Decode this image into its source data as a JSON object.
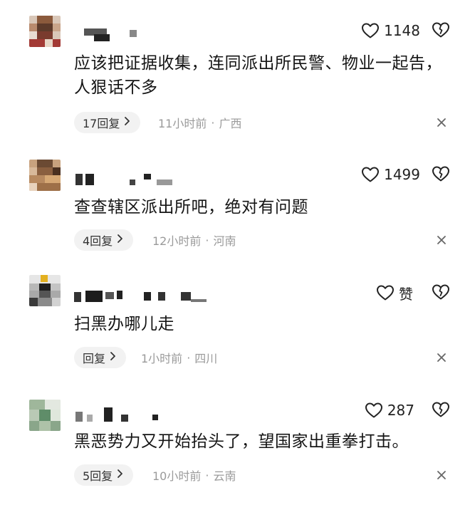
{
  "comments": [
    {
      "likes": "1148",
      "text": "应该把证据收集，连同派出所民警、物业一起告，人狠话不多",
      "reply_label": "17回复",
      "time": "11小时前",
      "location": "广西"
    },
    {
      "likes": "1499",
      "text": "查查辖区派出所吧，绝对有问题",
      "reply_label": "4回复",
      "time": "12小时前",
      "location": "河南"
    },
    {
      "likes": "赞",
      "text": "扫黑办哪儿走",
      "reply_label": "回复",
      "time": "1小时前",
      "location": "四川"
    },
    {
      "likes": "287",
      "text": "黑恶势力又开始抬头了，望国家出重拳打击。",
      "reply_label": "5回复",
      "time": "10小时前",
      "location": "云南"
    }
  ],
  "meta_separator": "·",
  "icons": {
    "like": "heart-icon",
    "dislike": "broken-heart-icon",
    "reply_chevron": "chevron-right-icon",
    "close": "close-icon"
  },
  "colors": {
    "text": "#151515",
    "meta": "#9a9a9a",
    "reply_bg": "#f2f2f2"
  }
}
